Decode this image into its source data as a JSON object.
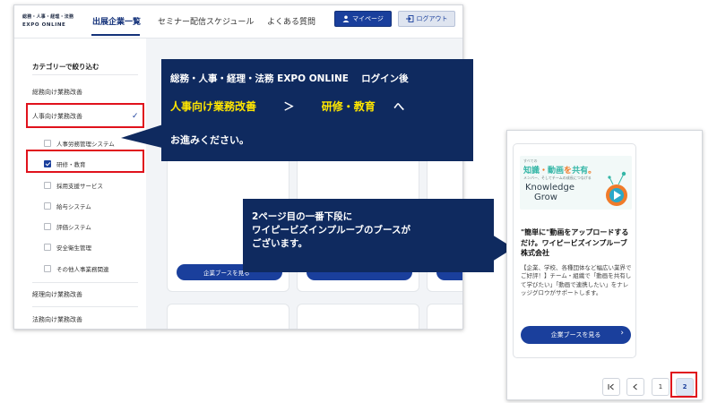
{
  "header": {
    "logo_line1": "総務・人事・経理・法務",
    "logo_line2": "EXPO ONLINE",
    "nav": [
      "出展企業一覧",
      "セミナー配信スケジュール",
      "よくある質問"
    ],
    "mypage_label": "マイページ",
    "logout_label": "ログアウト"
  },
  "sidebar": {
    "title": "カテゴリーで絞り込む",
    "categories": [
      "総務向け業務改善",
      "人事向け業務改善",
      "経理向け業務改善",
      "法務向け業務改善"
    ],
    "hr_subcategories": [
      "人事労務管理システム",
      "研修・教育",
      "採用支援サービス",
      "給与システム",
      "評価システム",
      "安全衛生管理",
      "その他人事業務関連"
    ]
  },
  "cards": {
    "booth_button_label": "企業ブースを見る"
  },
  "callout1": {
    "line1": "総務・人事・経理・法務 EXPO ONLINE　 ログイン後",
    "category": "人事向け業務改善",
    "separator": "＞",
    "subcategory": "研修・教育",
    "suffix": "へ",
    "line3": "お進みください。"
  },
  "callout2": {
    "line1": "2ページ目の一番下段に",
    "line2": "ワイピービズインプルーブのブースが",
    "line3": "ございます。"
  },
  "right_card": {
    "banner_small": "すべての",
    "banner_head_a": "知識",
    "banner_head_b": "・",
    "banner_head_c": "動画",
    "banner_head_d": "を",
    "banner_head_e": "共有",
    "banner_head_f": "。",
    "banner_tag": "メンバー、そしてチームの成長につなげる",
    "brand_line1": "Knowledge",
    "brand_line2": "Grow",
    "title": "\"簡単に\"動画をアップロードするだけ。ワイピービズインプルーブ株式会社",
    "description": "【企業、学校、各種団体など幅広い業界でご好評！】チーム・組織で「動画を共有して学びたい」「動画で連携したい」をナレッジグロウがサポートします。",
    "button_label": "企業ブースを見る"
  },
  "pagination": {
    "first": "|<",
    "prev": "<",
    "pages": [
      "1",
      "2"
    ],
    "current": "2"
  },
  "colors": {
    "brand_navy": "#1a3f9c",
    "callout_bg": "#0f2a5f",
    "highlight_yellow": "#ffe600",
    "annotation_red": "#e0121c"
  }
}
